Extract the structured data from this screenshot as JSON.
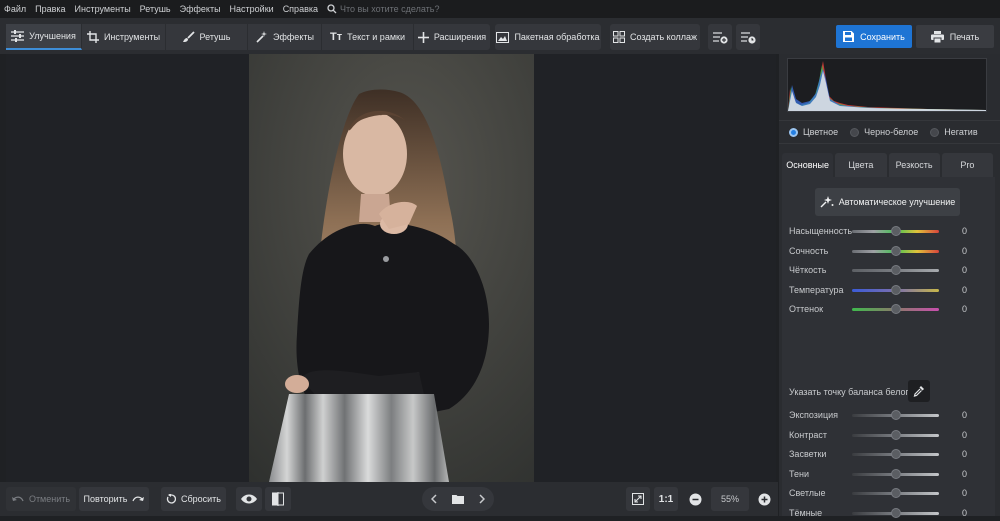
{
  "menu": [
    "Файл",
    "Правка",
    "Инструменты",
    "Ретушь",
    "Эффекты",
    "Настройки",
    "Справка"
  ],
  "search": {
    "placeholder": "Что вы хотите сделать?"
  },
  "tabs": [
    {
      "label": "Улучшения",
      "icon": "sliders-icon",
      "active": true
    },
    {
      "label": "Инструменты",
      "icon": "crop-icon",
      "active": false
    },
    {
      "label": "Ретушь",
      "icon": "brush-icon",
      "active": false
    },
    {
      "label": "Эффекты",
      "icon": "magic-wand-icon",
      "active": false
    },
    {
      "label": "Текст и рамки",
      "icon": "text-icon",
      "active": false
    },
    {
      "label": "Расширения",
      "icon": "plus-icon",
      "active": false
    }
  ],
  "toolbar": {
    "batch_label": "Пакетная обработка",
    "collage_label": "Создать коллаж",
    "save_label": "Сохранить",
    "print_label": "Печать"
  },
  "bottom": {
    "undo_label": "Отменить",
    "redo_label": "Повторить",
    "reset_label": "Сбросить",
    "fit_label": "",
    "one_to_one_label": "1:1",
    "zoom": "55%"
  },
  "panel": {
    "color_modes": [
      {
        "label": "Цветное",
        "selected": true
      },
      {
        "label": "Черно-белое",
        "selected": false
      },
      {
        "label": "Негатив",
        "selected": false
      }
    ],
    "tabs": [
      {
        "label": "Основные",
        "active": true
      },
      {
        "label": "Цвета",
        "active": false
      },
      {
        "label": "Резкость",
        "active": false
      },
      {
        "label": "Pro",
        "active": false
      }
    ],
    "auto_label": "Автоматическое улучшение",
    "white_balance_label": "Указать точку баланса белого",
    "sliders_top": [
      {
        "label": "Насыщенность",
        "value": "0",
        "level": 0.5,
        "colors": [
          "#6a6d73",
          "#9ea0a5",
          "#47c255",
          "#e0c23a",
          "#d8443c"
        ]
      },
      {
        "label": "Сочность",
        "value": "0",
        "level": 0.5,
        "colors": [
          "#6a6d73",
          "#9ea0a5",
          "#47c255",
          "#e0c23a",
          "#d8443c"
        ]
      },
      {
        "label": "Чёткость",
        "value": "0",
        "level": 0.5,
        "colors": [
          "#5c5f64",
          "#7a7d82",
          "#a7aaae"
        ]
      },
      {
        "label": "Температура",
        "value": "0",
        "level": 0.5,
        "colors": [
          "#3b5bd8",
          "#7b6fae",
          "#c7b74a"
        ]
      },
      {
        "label": "Оттенок",
        "value": "0",
        "level": 0.5,
        "colors": [
          "#3fba4d",
          "#8b7a6a",
          "#c94fae"
        ]
      }
    ],
    "sliders_bottom": [
      {
        "label": "Экспозиция",
        "value": "0",
        "level": 0.5,
        "colors": [
          "#3a3c40",
          "#7a7d82",
          "#c4c6c9"
        ]
      },
      {
        "label": "Контраст",
        "value": "0",
        "level": 0.5,
        "colors": [
          "#3a3c40",
          "#7a7d82",
          "#c4c6c9"
        ]
      },
      {
        "label": "Засветки",
        "value": "0",
        "level": 0.5,
        "colors": [
          "#3a3c40",
          "#7a7d82",
          "#c4c6c9"
        ]
      },
      {
        "label": "Тени",
        "value": "0",
        "level": 0.5,
        "colors": [
          "#3a3c40",
          "#7a7d82",
          "#c4c6c9"
        ]
      },
      {
        "label": "Светлые",
        "value": "0",
        "level": 0.5,
        "colors": [
          "#3a3c40",
          "#7a7d82",
          "#c4c6c9"
        ]
      },
      {
        "label": "Тёмные",
        "value": "0",
        "level": 0.5,
        "colors": [
          "#3a3c40",
          "#7a7d82",
          "#c4c6c9"
        ]
      }
    ]
  },
  "colors": {
    "accent": "#1e74d4",
    "panel": "#2a2c30",
    "workspace": "#202226"
  }
}
